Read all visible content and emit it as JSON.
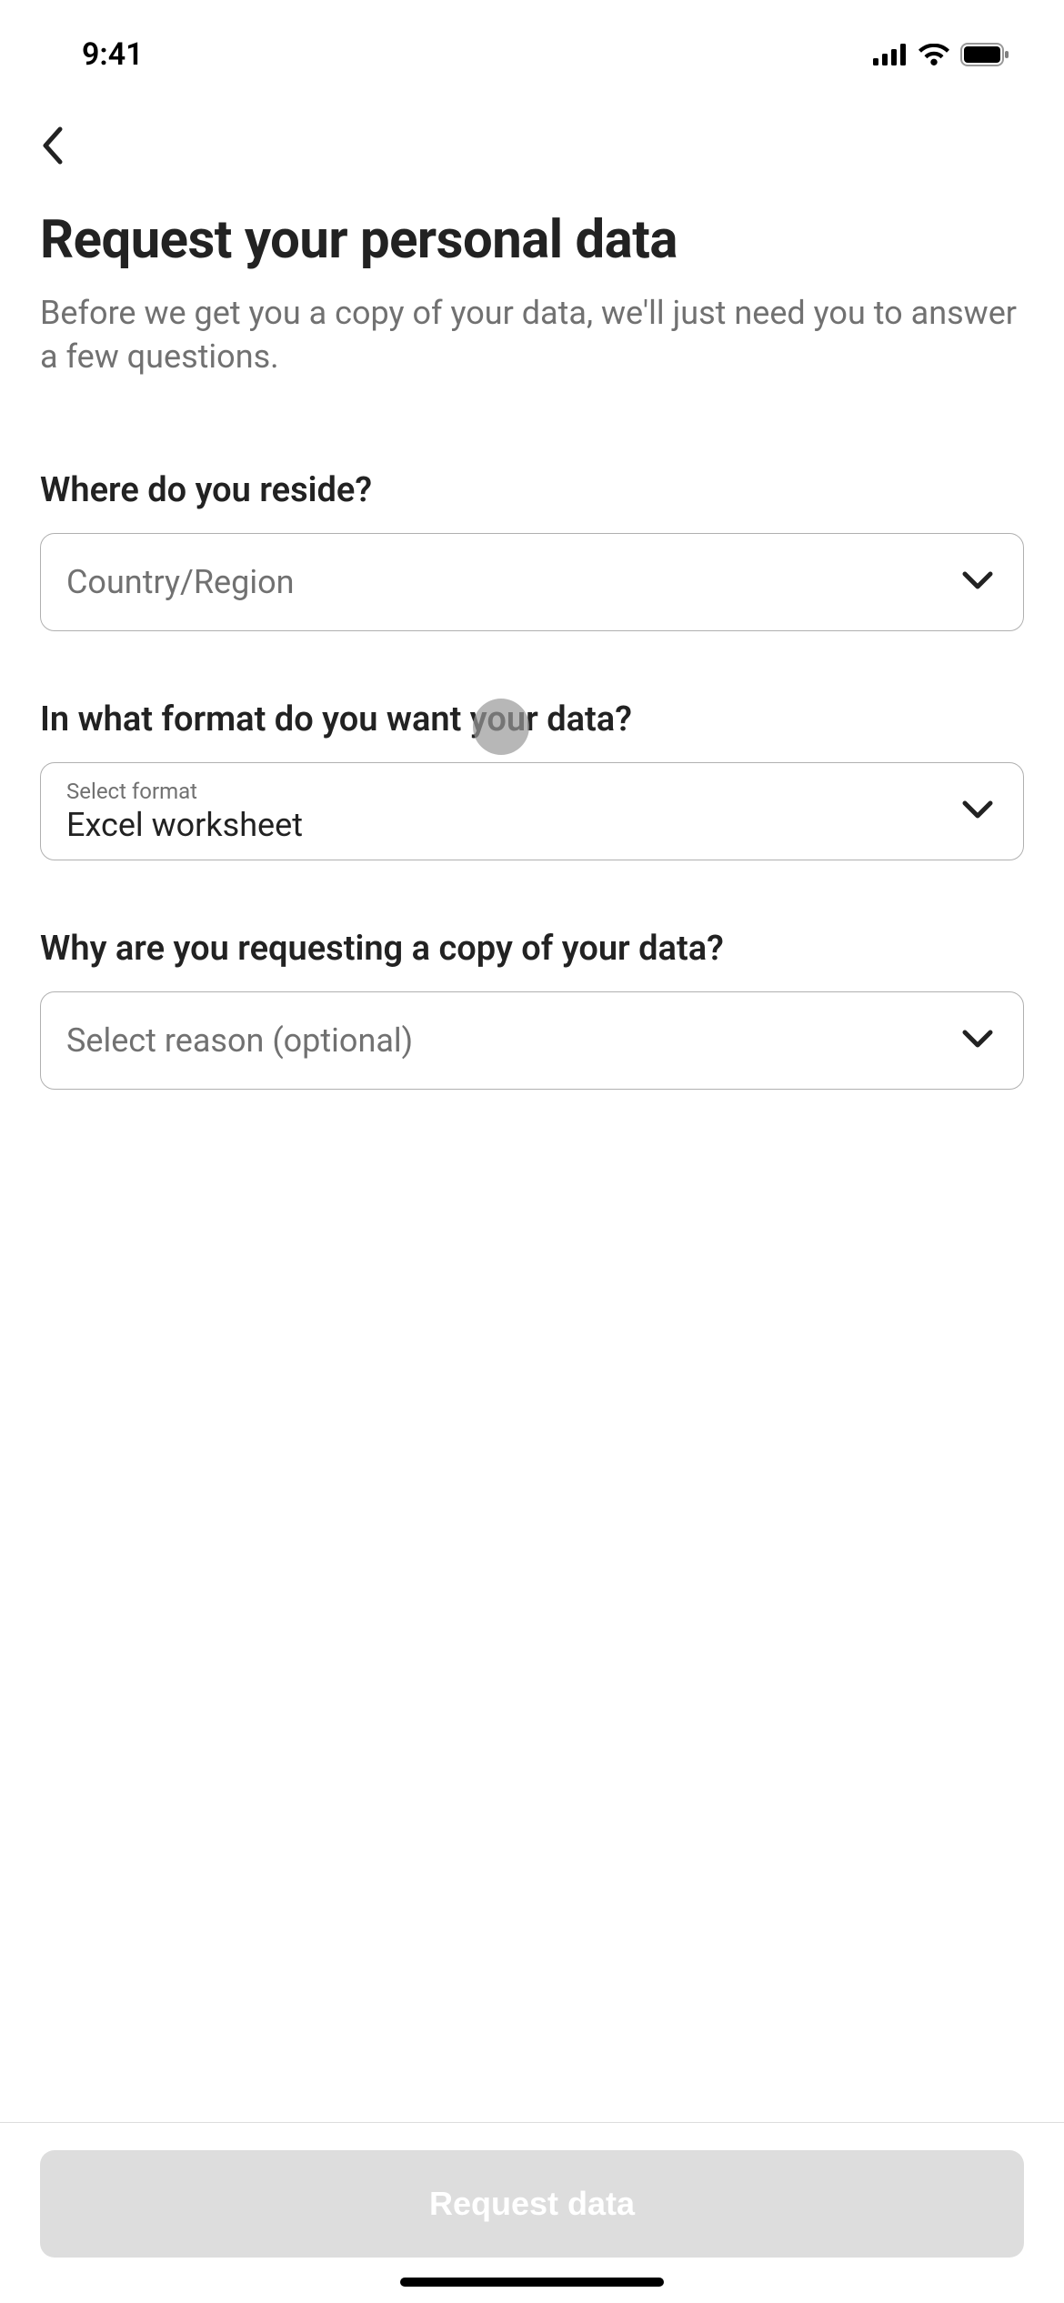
{
  "status_bar": {
    "time": "9:41"
  },
  "page": {
    "title": "Request your personal data",
    "subtitle": "Before we get you a copy of your data, we'll just need you to answer a few questions."
  },
  "form": {
    "country": {
      "label": "Where do you reside?",
      "placeholder": "Country/Region"
    },
    "format": {
      "label": "In what format do you want your data?",
      "small_label": "Select format",
      "value": "Excel worksheet"
    },
    "reason": {
      "label": "Why are you requesting a copy of your data?",
      "placeholder": "Select reason (optional)"
    }
  },
  "footer": {
    "submit_label": "Request data"
  }
}
